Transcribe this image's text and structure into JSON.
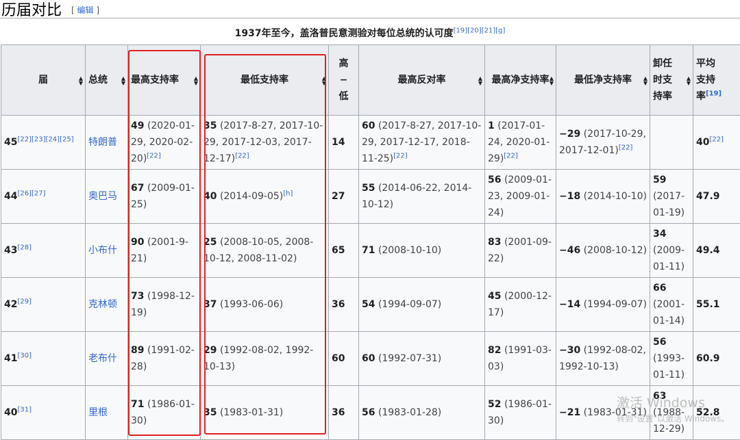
{
  "section": {
    "title": "历届对比",
    "edit_open": "[ ",
    "edit_label": "编辑",
    "edit_close": " ]"
  },
  "caption": {
    "text": "1937年至今，盖洛普民意测验对每位总统的认可度",
    "refs": [
      "[19]",
      "[20]",
      "[21]",
      "[g]"
    ]
  },
  "columns": {
    "term": "届",
    "president": "总统",
    "highest_approval": "最高支持率",
    "lowest_approval": "最低支持率",
    "high_low_1": "高",
    "high_low_2": "−",
    "high_low_3": "低",
    "highest_disapproval": "最高反对率",
    "highest_net": "最高净支持率",
    "lowest_net": "最低净支持率",
    "final_1": "卸任",
    "final_2": "时支",
    "final_3": "持率",
    "avg_1": "平均",
    "avg_2": "支持",
    "avg_3": "率",
    "avg_ref": "[19]"
  },
  "rows": [
    {
      "term": "45",
      "term_ref": "[22][23][24][25]",
      "president": "特朗普",
      "high_val": "49",
      "high_date": "(2020-01-29, 2020-02-20)",
      "high_ref": "[22]",
      "low_val": "35",
      "low_date": "(2017-8-27, 2017-10-29, 2017-12-03, 2017-12-17)",
      "low_ref": "[22]",
      "diff": "14",
      "dis_val": "60",
      "dis_date": "(2017-8-27, 2017-10-29, 2017-12-17, 2018-11-25)",
      "dis_ref": "[22]",
      "netmax_val": "1",
      "netmax_date": "(2017-01-24, 2020-01-29)",
      "netmax_ref": "[22]",
      "netmin_val": "−29",
      "netmin_date": "(2017-10-29, 2017-12-01)",
      "netmin_ref": "[22]",
      "final_val": "",
      "final_date": "",
      "avg": "40",
      "avg_ref": "[22]"
    },
    {
      "term": "44",
      "term_ref": "[26][27]",
      "president": "奥巴马",
      "high_val": "67",
      "high_date": "(2009-01-25)",
      "high_ref": "",
      "low_val": "40",
      "low_date": "(2014-09-05)",
      "low_ref": "[h]",
      "diff": "27",
      "dis_val": "55",
      "dis_date": "(2014-06-22, 2014-10-12)",
      "dis_ref": "",
      "netmax_val": "56",
      "netmax_date": "(2009-01-23, 2009-01-24)",
      "netmax_ref": "",
      "netmin_val": "−18",
      "netmin_date": "(2014-10-10)",
      "netmin_ref": "",
      "final_val": "59",
      "final_date": "(2017-01-19)",
      "avg": "47.9",
      "avg_ref": ""
    },
    {
      "term": "43",
      "term_ref": "[28]",
      "president": "小布什",
      "high_val": "90",
      "high_date": "(2001-9-21)",
      "high_ref": "",
      "low_val": "25",
      "low_date": "(2008-10-05, 2008-10-12, 2008-11-02)",
      "low_ref": "",
      "diff": "65",
      "dis_val": "71",
      "dis_date": "(2008-10-10)",
      "dis_ref": "",
      "netmax_val": "83",
      "netmax_date": "(2001-09-22)",
      "netmax_ref": "",
      "netmin_val": "−46",
      "netmin_date": "(2008-10-12)",
      "netmin_ref": "",
      "final_val": "34",
      "final_date": "(2009-01-11)",
      "avg": "49.4",
      "avg_ref": ""
    },
    {
      "term": "42",
      "term_ref": "[29]",
      "president": "克林顿",
      "high_val": "73",
      "high_date": "(1998-12-19)",
      "high_ref": "",
      "low_val": "37",
      "low_date": "(1993-06-06)",
      "low_ref": "",
      "diff": "36",
      "dis_val": "54",
      "dis_date": "(1994-09-07)",
      "dis_ref": "",
      "netmax_val": "45",
      "netmax_date": "(2000-12-17)",
      "netmax_ref": "",
      "netmin_val": "−14",
      "netmin_date": "(1994-09-07)",
      "netmin_ref": "",
      "final_val": "66",
      "final_date": "(2001-01-14)",
      "avg": "55.1",
      "avg_ref": ""
    },
    {
      "term": "41",
      "term_ref": "[30]",
      "president": "老布什",
      "high_val": "89",
      "high_date": "(1991-02-28)",
      "high_ref": "",
      "low_val": "29",
      "low_date": "(1992-08-02, 1992-10-13)",
      "low_ref": "",
      "diff": "60",
      "dis_val": "60",
      "dis_date": "(1992-07-31)",
      "dis_ref": "",
      "netmax_val": "82",
      "netmax_date": "(1991-03-03)",
      "netmax_ref": "",
      "netmin_val": "−30",
      "netmin_date": "(1992-08-02, 1992-10-13)",
      "netmin_ref": "",
      "final_val": "56",
      "final_date": "(1993-01-11)",
      "avg": "60.9",
      "avg_ref": ""
    },
    {
      "term": "40",
      "term_ref": "[31]",
      "president": "里根",
      "high_val": "71",
      "high_date": "(1986-01-30)",
      "high_ref": "",
      "low_val": "35",
      "low_date": "(1983-01-31)",
      "low_ref": "",
      "diff": "36",
      "dis_val": "56",
      "dis_date": "(1983-01-28)",
      "dis_ref": "",
      "netmax_val": "52",
      "netmax_date": "(1986-01-30)",
      "netmax_ref": "",
      "netmin_val": "−21",
      "netmin_date": "(1983-01-31)",
      "netmin_ref": "",
      "final_val": "63",
      "final_date": "(1988-12-29)",
      "avg": "52.8",
      "avg_ref": ""
    }
  ],
  "watermark": {
    "line1": "激活 Windows",
    "line2": "转到\"设置\"以激活 Windows。"
  },
  "colors": {
    "link": "#3366cc",
    "header_bg": "#eaecf0",
    "cell_bg": "#f8f9fa",
    "border": "#a2a9b1",
    "highlight_box": "#e02020"
  }
}
